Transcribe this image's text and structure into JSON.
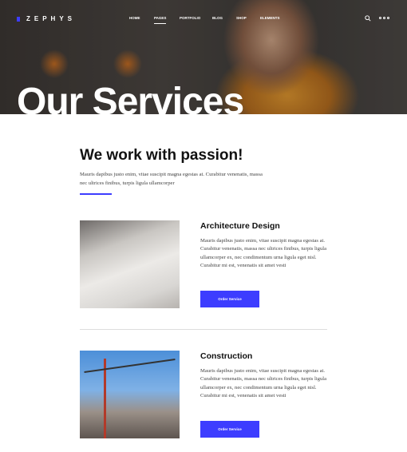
{
  "header": {
    "logo": "ZEPHYS",
    "nav": [
      {
        "label": "HOME"
      },
      {
        "label": "PAGES"
      },
      {
        "label": "PORTFOLIO"
      },
      {
        "label": "BLOG"
      },
      {
        "label": "SHOP"
      },
      {
        "label": "ELEMENTS"
      }
    ],
    "active": "PAGES"
  },
  "hero": {
    "title": "Our Services"
  },
  "intro": {
    "heading": "We work with passion!",
    "text": "Mauris dapibus justo enim, vitae suscipit magna egestas at. Curabitur venenatis, massa nec ultrices finibus, turpis ligula ullamcorper"
  },
  "services": [
    {
      "title": "Architecture Design",
      "text": "Mauris dapibus justo enim, vitae suscipit magna egestas at. Curabitur venenatis, massa nec ultrices finibus, turpis ligula ullamcorper ex, nec condimentum urna ligula eget nisl. Curabitur mi est, venenatis sit amet vesti",
      "button": "Order Service"
    },
    {
      "title": "Construction",
      "text": "Mauris dapibus justo enim, vitae suscipit magna egestas at. Curabitur venenatis, massa nec ultrices finibus, turpis ligula ullamcorper ex, nec condimentum urna ligula eget nisl. Curabitur mi est, venenatis sit amet vesti",
      "button": "Order Service"
    }
  ],
  "colors": {
    "accent": "#3d3dff"
  }
}
